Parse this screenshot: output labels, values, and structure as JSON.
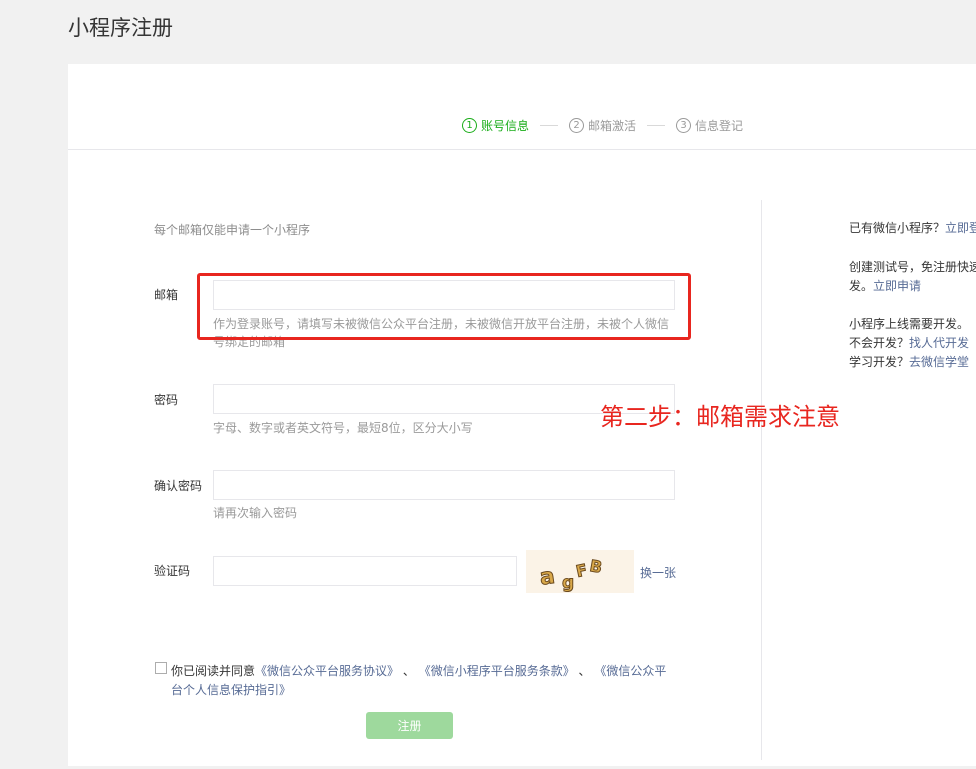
{
  "page": {
    "title": "小程序注册"
  },
  "steps": [
    {
      "num": "1",
      "label": "账号信息"
    },
    {
      "num": "2",
      "label": "邮箱激活"
    },
    {
      "num": "3",
      "label": "信息登记"
    }
  ],
  "form": {
    "hint": "每个邮箱仅能申请一个小程序",
    "email_label": "邮箱",
    "email_tip": "作为登录账号，请填写未被微信公众平台注册，未被微信开放平台注册，未被个人微信号绑定的邮箱",
    "password_label": "密码",
    "password_tip": "字母、数字或者英文符号，最短8位，区分大小写",
    "confirm_label": "确认密码",
    "confirm_tip": "请再次输入密码",
    "captcha_label": "验证码",
    "captcha_text": "agFB",
    "refresh_label": "换一张",
    "agree_prefix": "你已阅读并同意",
    "agree_link1": "《微信公众平台服务协议》",
    "agree_sep1": "、",
    "agree_link2": "《微信小程序平台服务条款》",
    "agree_sep2": "、",
    "agree_link3": "《微信公众平台个人信息保护指引》",
    "submit_label": "注册"
  },
  "annotation": {
    "text": "第二步：邮箱需求注意"
  },
  "side": {
    "has_miniapp": "已有微信小程序？",
    "login_link": "立即登",
    "test_line1": "创建测试号，免注册快速",
    "test_line2_prefix": "发。",
    "apply_link": "立即申请",
    "dev_need": "小程序上线需要开发。",
    "no_dev": "不会开发？",
    "find_agent_link": "找人代开发",
    "learn_dev": "学习开发？",
    "school_link": "去微信学堂"
  },
  "colors": {
    "accent": "#1aad19",
    "link": "#576b95",
    "annotation": "#e8261f"
  }
}
